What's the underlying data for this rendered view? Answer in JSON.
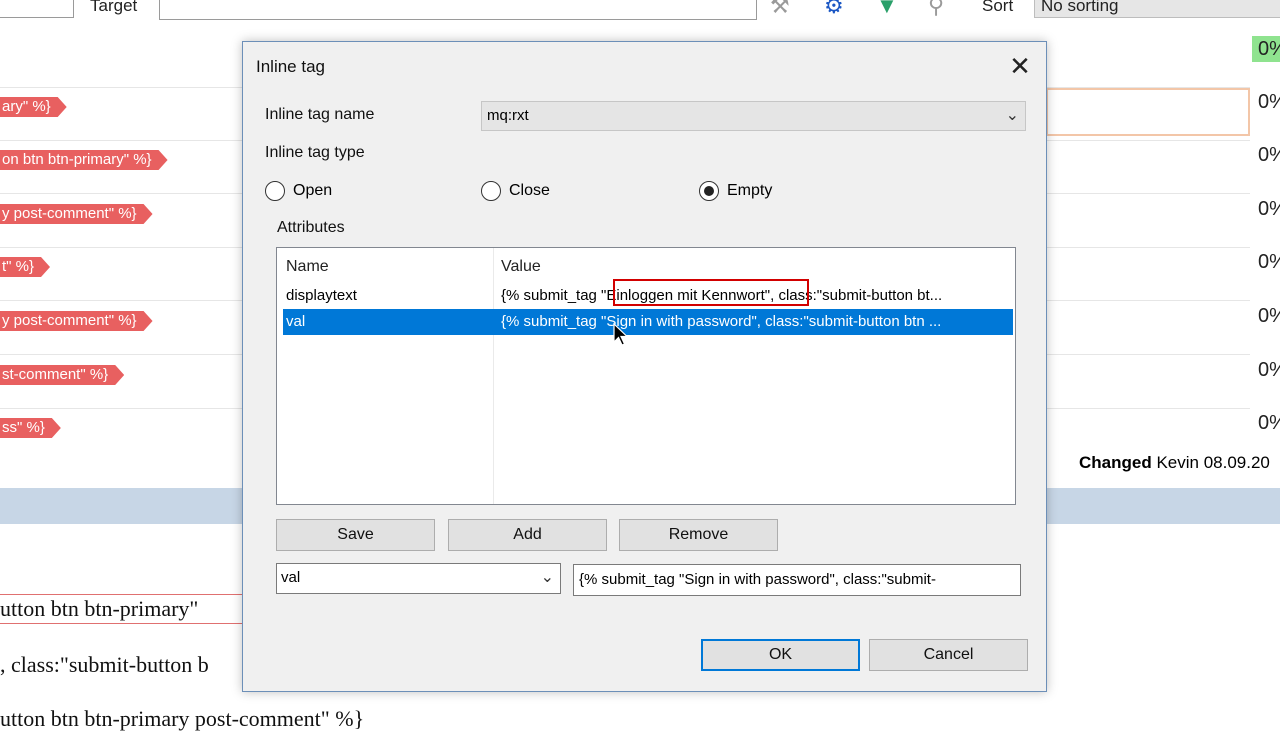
{
  "background": {
    "target_label": "Target",
    "sort_label": "Sort",
    "sort_value": "No sorting",
    "toolbar_icons": [
      "filter-icon",
      "gear-icon",
      "funnel-icon",
      "search-icon"
    ],
    "rows": [
      {
        "tag": "",
        "pct": "0%"
      },
      {
        "tag": "ary\" %}",
        "pct": "0%"
      },
      {
        "tag": "on btn btn-primary\" %}",
        "pct": "0%"
      },
      {
        "tag": "y post-comment\" %}",
        "pct": "0%"
      },
      {
        "tag": "t\" %}",
        "pct": "0%"
      },
      {
        "tag": "y post-comment\" %}",
        "pct": "0%"
      },
      {
        "tag": "st-comment\" %}",
        "pct": "0%"
      },
      {
        "tag": "ss\" %}",
        "pct": "0%"
      }
    ],
    "changed_label": "Changed",
    "changed_value": "Kevin 08.09.20",
    "text_line_1": "utton btn btn-primary\" ",
    "text_line_2": ", class:\"submit-button b",
    "text_line_3": "utton btn btn-primary post-comment\" %}"
  },
  "dialog": {
    "title": "Inline tag",
    "tag_name_label": "Inline tag name",
    "tag_name_value": "mq:rxt",
    "tag_type_label": "Inline tag type",
    "types": [
      {
        "label": "Open",
        "selected": false
      },
      {
        "label": "Close",
        "selected": false
      },
      {
        "label": "Empty",
        "selected": true
      }
    ],
    "attributes_label": "Attributes",
    "columns": {
      "name": "Name",
      "value": "Value"
    },
    "attributes": [
      {
        "name": "displaytext",
        "value": "{% submit_tag \"Einloggen mit Kennwort\", class:\"submit-button bt..."
      },
      {
        "name": "val",
        "value": "{% submit_tag \"Sign in with password\", class:\"submit-button btn ..."
      }
    ],
    "buttons": {
      "save": "Save",
      "add": "Add",
      "remove": "Remove",
      "ok": "OK",
      "cancel": "Cancel"
    },
    "attribute_select_value": "val",
    "attribute_value_input": "{% submit_tag \"Sign in with password\", class:\"submit-"
  },
  "colors": {
    "accent": "#0078d7",
    "tag_red": "#e86060",
    "highlight_red": "#d20000",
    "progress_green": "#8fe38f"
  }
}
